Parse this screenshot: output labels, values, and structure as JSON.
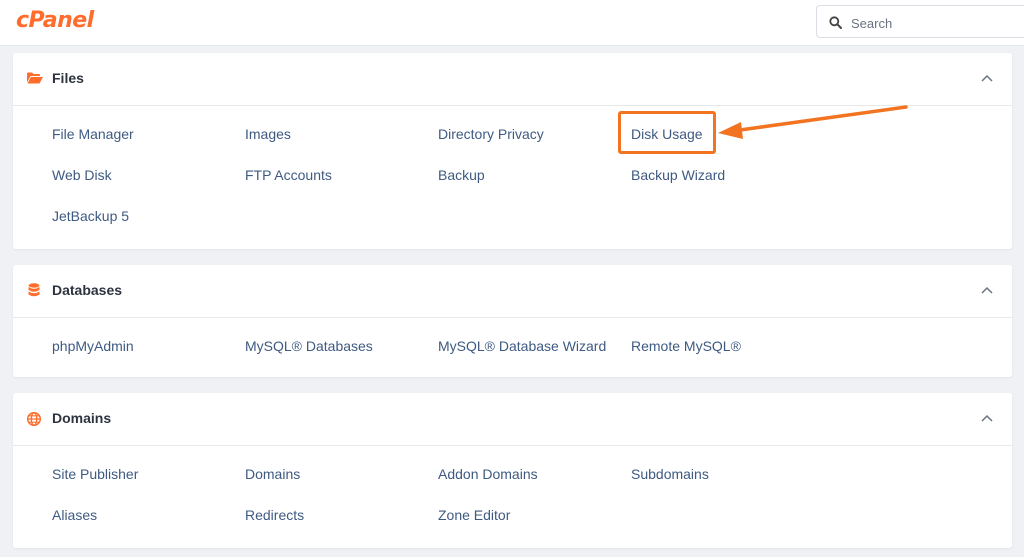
{
  "header": {
    "logo_text": "cPanel",
    "search_placeholder": "Search"
  },
  "colors": {
    "brand": "#ff6c2c",
    "link": "#3f5a82",
    "highlight": "#f27420"
  },
  "sections": {
    "files": {
      "title": "Files",
      "icon": "folder-open-icon",
      "items": [
        "File Manager",
        "Images",
        "Directory Privacy",
        "Disk Usage",
        "Web Disk",
        "FTP Accounts",
        "Backup",
        "Backup Wizard",
        "JetBackup 5"
      ]
    },
    "databases": {
      "title": "Databases",
      "icon": "database-icon",
      "items": [
        "phpMyAdmin",
        "MySQL® Databases",
        "MySQL® Database Wizard",
        "Remote MySQL®"
      ]
    },
    "domains": {
      "title": "Domains",
      "icon": "globe-icon",
      "items": [
        "Site Publisher",
        "Domains",
        "Addon Domains",
        "Subdomains",
        "Aliases",
        "Redirects",
        "Zone Editor"
      ]
    }
  },
  "annotation": {
    "highlighted_item": "Disk Usage",
    "pointer": "arrow-annotation"
  }
}
